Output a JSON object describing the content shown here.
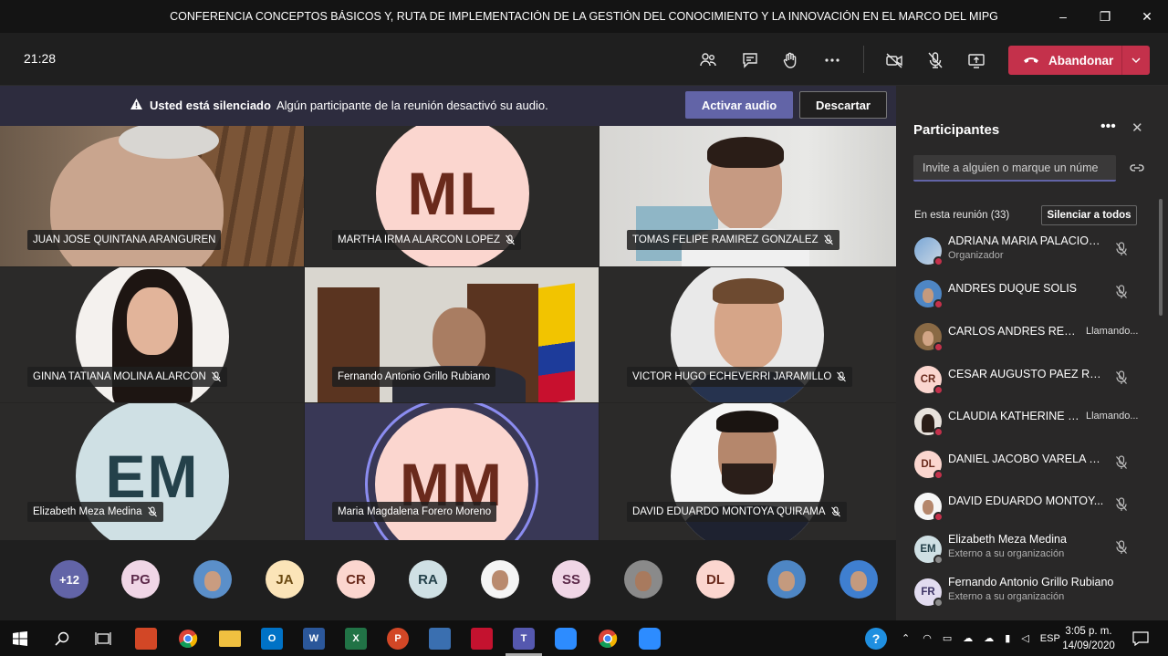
{
  "window": {
    "title": "CONFERENCIA CONCEPTOS BÁSICOS Y, RUTA DE IMPLEMENTACIÓN DE LA GESTIÓN DEL CONOCIMIENTO Y LA INNOVACIÓN EN EL MARCO DEL MIPG",
    "minimize": "–",
    "maximize": "❐",
    "close": "✕"
  },
  "toolbar": {
    "clock": "21:28",
    "leave_label": "Abandonar"
  },
  "banner": {
    "bold": "Usted está silenciado",
    "message": "Algún participante de la reunión desactivó su audio.",
    "activate_label": "Activar audio",
    "dismiss_label": "Descartar"
  },
  "tiles": [
    {
      "name": "JUAN JOSE QUINTANA ARANGUREN"
    },
    {
      "name": "MARTHA IRMA ALARCON LOPEZ",
      "initials": "ML"
    },
    {
      "name": "TOMAS FELIPE RAMIREZ GONZALEZ"
    },
    {
      "name": "GINNA TATIANA MOLINA ALARCON"
    },
    {
      "name": "Fernando Antonio Grillo Rubiano"
    },
    {
      "name": "VICTOR HUGO ECHEVERRI JARAMILLO"
    },
    {
      "name": "Elizabeth Meza Medina",
      "initials": "EM"
    },
    {
      "name": "Maria Magdalena Forero Moreno",
      "initials": "MM"
    },
    {
      "name": "DAVID EDUARDO MONTOYA QUIRAMA"
    }
  ],
  "strip": {
    "more": "+12",
    "avatars": [
      "PG",
      "JA",
      "CR",
      "RA",
      "SS",
      "DL"
    ]
  },
  "panel": {
    "title": "Participantes",
    "more": "•••",
    "close": "✕",
    "invite_placeholder": "Invite a alguien o marque un núme",
    "in_meeting": "En esta reunión (33)",
    "mute_all": "Silenciar a todos",
    "participants": [
      {
        "name": "ADRIANA MARIA PALACIOS...",
        "sub": "Organizador"
      },
      {
        "name": "ANDRES DUQUE SOLIS"
      },
      {
        "name": "CARLOS ANDRES REGA...",
        "status": "Llamando..."
      },
      {
        "name": "CESAR AUGUSTO PAEZ RA...",
        "initials": "CR"
      },
      {
        "name": "CLAUDIA KATHERINE O...",
        "status": "Llamando..."
      },
      {
        "name": "DANIEL JACOBO VARELA LE...",
        "initials": "DL"
      },
      {
        "name": "DAVID EDUARDO MONTOY..."
      },
      {
        "name": "Elizabeth Meza Medina",
        "initials": "EM",
        "sub": "Externo a su organización"
      },
      {
        "name": "Fernando Antonio Grillo Rubiano",
        "initials": "FR",
        "sub": "Externo a su organización"
      }
    ]
  },
  "taskbar": {
    "language": "ESP",
    "time": "3:05 p. m.",
    "date": "14/09/2020",
    "help": "?"
  },
  "colors": {
    "accent": "#6264a7",
    "leave": "#c4314b"
  }
}
